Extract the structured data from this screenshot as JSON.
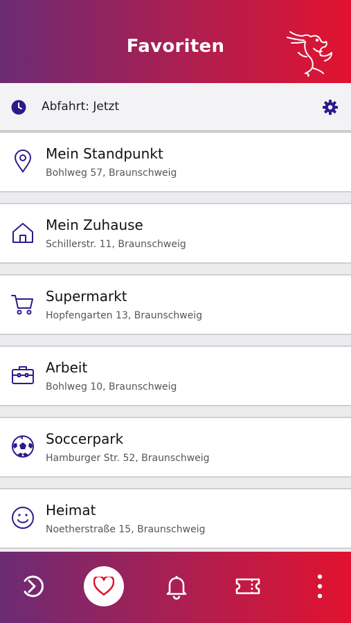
{
  "header": {
    "title": "Favoriten",
    "logo_icon": "lion-logo-icon"
  },
  "departure": {
    "label": "Abfahrt: Jetzt",
    "clock_icon": "clock-icon",
    "settings_icon": "gear-icon"
  },
  "favorites": [
    {
      "title": "Mein Standpunkt",
      "address": "Bohlweg 57, Braunschweig",
      "icon": "location-pin-icon"
    },
    {
      "title": "Mein Zuhause",
      "address": "Schillerstr. 11, Braunschweig",
      "icon": "home-icon"
    },
    {
      "title": "Supermarkt",
      "address": "Hopfengarten 13, Braunschweig",
      "icon": "shopping-cart-icon"
    },
    {
      "title": "Arbeit",
      "address": "Bohlweg 10, Braunschweig",
      "icon": "briefcase-icon"
    },
    {
      "title": "Soccerpark",
      "address": "Hamburger Str. 52, Braunschweig",
      "icon": "soccer-ball-icon"
    },
    {
      "title": "Heimat",
      "address": "Noetherstraße 15, Braunschweig",
      "icon": "smiley-icon"
    }
  ],
  "bottom_nav": {
    "items": [
      "journey-icon",
      "heart-icon",
      "bell-icon",
      "ticket-icon",
      "more-vertical-icon"
    ],
    "active": "heart-icon"
  },
  "colors": {
    "accent": "#2d1a8c",
    "gradient_start": "#6b2b74",
    "gradient_end": "#e2122f"
  }
}
